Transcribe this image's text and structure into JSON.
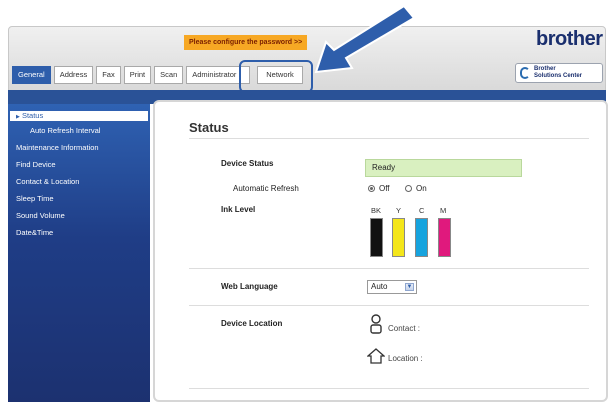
{
  "header": {
    "notice": "Please configure the password >>",
    "logo": "brother",
    "solutions": {
      "line1": "Brother",
      "line2": "Solutions Center"
    },
    "tabs": [
      {
        "label": "General"
      },
      {
        "label": "Address"
      },
      {
        "label": "Fax"
      },
      {
        "label": "Print"
      },
      {
        "label": "Scan"
      },
      {
        "label": "Administrator"
      },
      {
        "label": "Network"
      }
    ]
  },
  "sidebar": {
    "items": [
      {
        "label": "Status"
      },
      {
        "label": "Auto Refresh Interval"
      },
      {
        "label": "Maintenance Information"
      },
      {
        "label": "Find Device"
      },
      {
        "label": "Contact & Location"
      },
      {
        "label": "Sleep Time"
      },
      {
        "label": "Sound Volume"
      },
      {
        "label": "Date&Time"
      }
    ]
  },
  "main": {
    "title": "Status",
    "device_status_label": "Device Status",
    "device_status_value": "Ready",
    "auto_refresh_label": "Automatic Refresh",
    "refresh_off": "Off",
    "refresh_on": "On",
    "ink_level_label": "Ink Level",
    "inks": [
      {
        "label": "BK",
        "color": "#111111"
      },
      {
        "label": "Y",
        "color": "#f4e61a"
      },
      {
        "label": "C",
        "color": "#16a3de"
      },
      {
        "label": "M",
        "color": "#e0197d"
      }
    ],
    "web_language_label": "Web Language",
    "web_language_value": "Auto",
    "device_location_label": "Device Location",
    "contact_label": "Contact :",
    "location_label": "Location :"
  },
  "colors": {
    "accent": "#2e5eab",
    "notice_bg": "#f7a824",
    "status_bg": "#d9f0c0"
  }
}
